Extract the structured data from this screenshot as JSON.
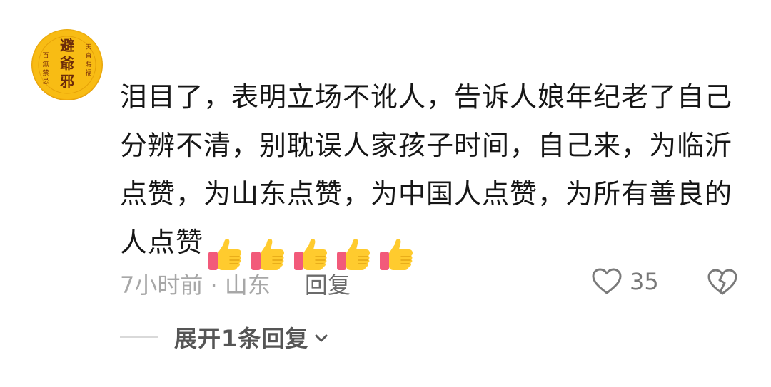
{
  "comment": {
    "text": "泪目了，表明立场不讹人，告诉人娘年纪老了自己分辨不清，别耽误人家孩子时间，自己来，为临沂点赞，为山东点赞，为中国人点赞，为所有善良的人点赞",
    "emoji": "thumbs-up",
    "emoji_count": 5,
    "time_location": "7小时前 · 山东",
    "reply_label": "回复",
    "like_count": "35",
    "expand_replies_label": "展开1条回复"
  },
  "avatar": {
    "characters": [
      "避",
      "爺",
      "邪",
      "天",
      "官",
      "賜",
      "福",
      "百",
      "無",
      "禁",
      "忌"
    ]
  },
  "colors": {
    "text": "#161616",
    "meta": "#a7a7a7",
    "avatar_yellow": "#f6b50e"
  }
}
